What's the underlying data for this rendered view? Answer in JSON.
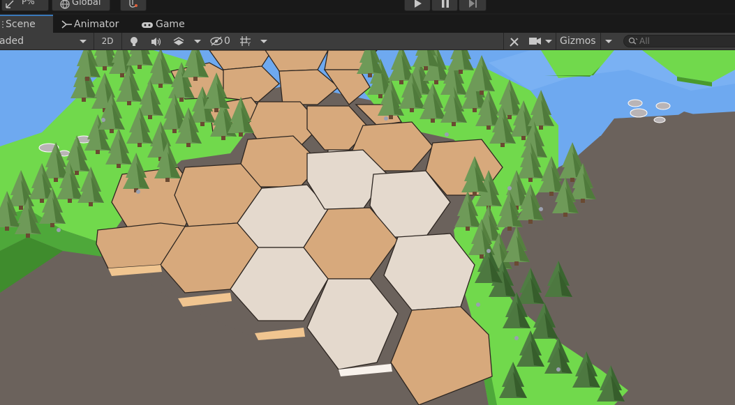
{
  "topbar": {
    "pivot_label": "P%",
    "global_label": "Global",
    "play_icon": "play-icon",
    "pause_icon": "pause-icon",
    "step_icon": "step-icon"
  },
  "tabs": [
    {
      "label": "Scene",
      "icon": "scene-icon",
      "active": true
    },
    {
      "label": "Animator",
      "icon": "animator-icon",
      "active": false
    },
    {
      "label": "Game",
      "icon": "gamepad-icon",
      "active": false
    }
  ],
  "toolbar": {
    "shading_mode": "Shaded",
    "shading_visible": "aded",
    "mode_2d": "2D",
    "hidden_count": "0",
    "gizmos_label": "Gizmos",
    "search_placeholder": "All"
  },
  "colors": {
    "accent": "#3a79bb",
    "ground": "#6b625c",
    "water": "#6ea9f0",
    "grass": "#71d94c",
    "sand": "#d7a97c",
    "white_tile": "#e4d9cd",
    "tree": "#6e9a58"
  }
}
